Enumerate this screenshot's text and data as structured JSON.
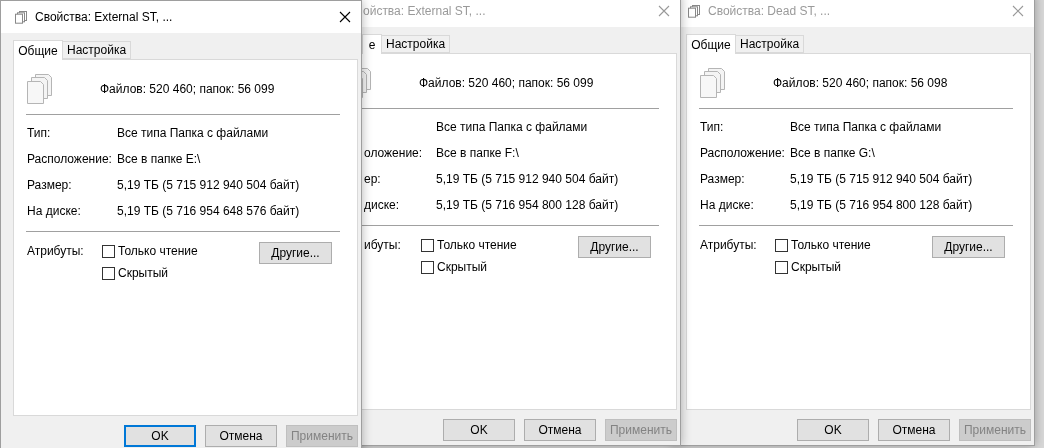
{
  "windows": [
    {
      "title": "Свойства: External ST, ...",
      "active": true,
      "tabs": [
        {
          "label": "Общие",
          "selected": true
        },
        {
          "label": "Настройка",
          "selected": false
        }
      ],
      "summary": "Файлов: 520 460; папок: 56 099",
      "properties": [
        {
          "label": "Тип:",
          "value": "Все типа Папка с файлами"
        },
        {
          "label": "Расположение:",
          "value": "Все в папке E:\\"
        },
        {
          "label": "Размер:",
          "value": "5,19 ТБ (5 715 912 940 504 байт)"
        },
        {
          "label": "На диске:",
          "value": "5,19 ТБ (5 716 954 648 576 байт)"
        }
      ],
      "attributes_label": "Атрибуты:",
      "attributes": [
        {
          "label": "Только чтение",
          "checked": false
        },
        {
          "label": "Скрытый",
          "checked": false
        }
      ],
      "other_button": "Другие...",
      "buttons": [
        {
          "label": "OK",
          "focused": true,
          "disabled": false
        },
        {
          "label": "Отмена",
          "focused": false,
          "disabled": false
        },
        {
          "label": "Применить",
          "focused": false,
          "disabled": true
        }
      ]
    },
    {
      "title": "ойства: External ST, ...",
      "active": false,
      "tabs": [
        {
          "label": "е",
          "selected": true
        },
        {
          "label": "Настройка",
          "selected": false
        }
      ],
      "summary": "Файлов: 520 460; папок: 56 099",
      "properties": [
        {
          "value": "Все типа Папка с файлами"
        },
        {
          "label": "оложение:",
          "value": "Все в папке F:\\"
        },
        {
          "label": "ер:",
          "value": "5,19 ТБ (5 715 912 940 504 байт)"
        },
        {
          "label": "диске:",
          "value": "5,19 ТБ (5 716 954 800 128 байт)"
        }
      ],
      "attributes_label": "ибуты:",
      "attributes": [
        {
          "label": "Только чтение",
          "checked": false
        },
        {
          "label": "Скрытый",
          "checked": false
        }
      ],
      "other_button": "Другие...",
      "buttons": [
        {
          "label": "OK",
          "focused": false,
          "disabled": false
        },
        {
          "label": "Отмена",
          "focused": false,
          "disabled": false
        },
        {
          "label": "Применить",
          "focused": false,
          "disabled": true
        }
      ]
    },
    {
      "title": "Свойства: Dead ST, ...",
      "active": false,
      "tabs": [
        {
          "label": "Общие",
          "selected": true
        },
        {
          "label": "Настройка",
          "selected": false
        }
      ],
      "summary": "Файлов: 520 460; папок: 56 098",
      "properties": [
        {
          "label": "Тип:",
          "value": "Все типа Папка с файлами"
        },
        {
          "label": "Расположение:",
          "value": "Все в папке G:\\"
        },
        {
          "label": "Размер:",
          "value": "5,19 ТБ (5 715 912 940 504 байт)"
        },
        {
          "label": "На диске:",
          "value": "5,19 ТБ (5 716 954 800 128 байт)"
        }
      ],
      "attributes_label": "Атрибуты:",
      "attributes": [
        {
          "label": "Только чтение",
          "checked": false
        },
        {
          "label": "Скрытый",
          "checked": false
        }
      ],
      "other_button": "Другие...",
      "buttons": [
        {
          "label": "OK",
          "focused": false,
          "disabled": false
        },
        {
          "label": "Отмена",
          "focused": false,
          "disabled": false
        },
        {
          "label": "Применить",
          "focused": false,
          "disabled": true
        }
      ]
    }
  ]
}
